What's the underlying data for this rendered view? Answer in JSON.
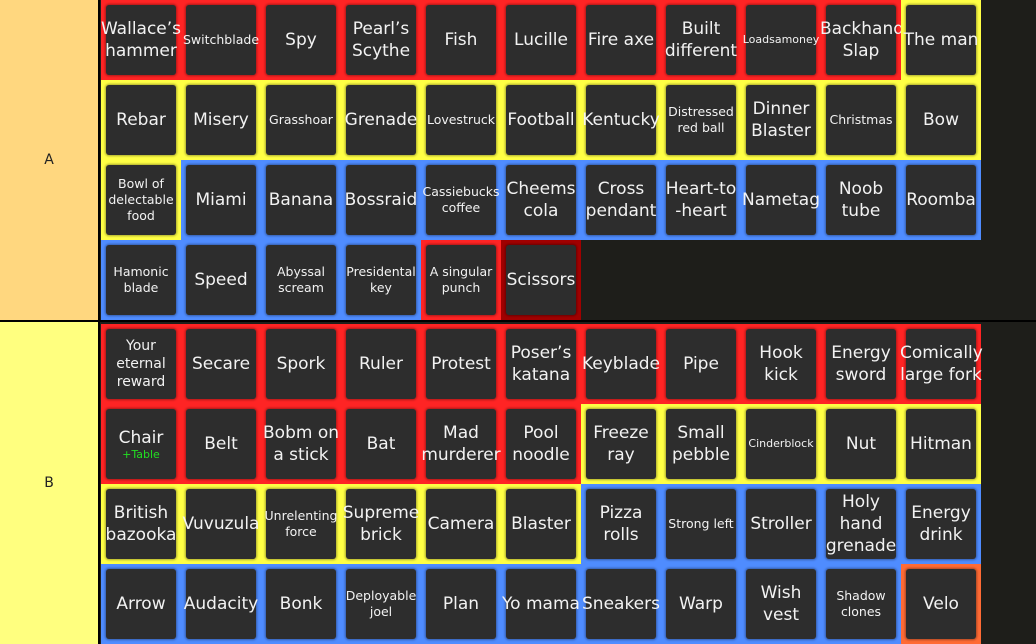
{
  "tiers": [
    {
      "label": "A",
      "items": [
        {
          "name": "Wallace's hammer",
          "color": "red",
          "size": "md"
        },
        {
          "name": "Switchblade",
          "color": "red",
          "size": "xs"
        },
        {
          "name": "Spy",
          "color": "red",
          "size": "lg"
        },
        {
          "name": "Pearl's Scythe",
          "color": "red",
          "size": "md"
        },
        {
          "name": "Fish",
          "color": "red",
          "size": "lg"
        },
        {
          "name": "Lucille",
          "color": "red",
          "size": "lg"
        },
        {
          "name": "Fire axe",
          "color": "red",
          "size": "lg"
        },
        {
          "name": "Built different",
          "color": "red",
          "size": "md"
        },
        {
          "name": "Loadsamoney",
          "color": "red",
          "size": "xxs"
        },
        {
          "name": "Backhand Slap",
          "color": "red",
          "size": "md"
        },
        {
          "name": "The man",
          "color": "yellow",
          "size": "lg"
        },
        {
          "name": "Rebar",
          "color": "yellow",
          "size": "lg"
        },
        {
          "name": "Misery",
          "color": "yellow",
          "size": "lg"
        },
        {
          "name": "Grasshoar",
          "color": "yellow",
          "size": "xs"
        },
        {
          "name": "Grenade",
          "color": "yellow",
          "size": "lg"
        },
        {
          "name": "Lovestruck",
          "color": "yellow",
          "size": "xs"
        },
        {
          "name": "Football",
          "color": "yellow",
          "size": "lg"
        },
        {
          "name": "Kentucky",
          "color": "yellow",
          "size": "md"
        },
        {
          "name": "Distressed red ball",
          "color": "yellow",
          "size": "xs"
        },
        {
          "name": "Dinner Blaster",
          "color": "yellow",
          "size": "md"
        },
        {
          "name": "Christmas",
          "color": "yellow",
          "size": "xs"
        },
        {
          "name": "Bow",
          "color": "yellow",
          "size": "lg"
        },
        {
          "name": "Bowl of delectable food",
          "color": "yellow",
          "size": "xs"
        },
        {
          "name": "Miami",
          "color": "blue",
          "size": "lg"
        },
        {
          "name": "Banana",
          "color": "blue",
          "size": "lg"
        },
        {
          "name": "Bossraid",
          "color": "blue",
          "size": "md"
        },
        {
          "name": "Cassiebucks coffee",
          "color": "blue",
          "size": "xs"
        },
        {
          "name": "Cheems cola",
          "color": "blue",
          "size": "md"
        },
        {
          "name": "Cross pendant",
          "color": "blue",
          "size": "md"
        },
        {
          "name": "Heart-to -heart",
          "color": "blue",
          "size": "md"
        },
        {
          "name": "Nametag",
          "color": "blue",
          "size": "md"
        },
        {
          "name": "Noob tube",
          "color": "blue",
          "size": "md"
        },
        {
          "name": "Roomba",
          "color": "blue",
          "size": "md"
        },
        {
          "name": "Hamonic blade",
          "color": "blue",
          "size": "xs"
        },
        {
          "name": "Speed",
          "color": "blue",
          "size": "lg"
        },
        {
          "name": "Abyssal scream",
          "color": "blue",
          "size": "xs"
        },
        {
          "name": "Presidental key",
          "color": "blue",
          "size": "xs"
        },
        {
          "name": "A singular punch",
          "color": "red",
          "size": "xs"
        },
        {
          "name": "Scissors",
          "color": "darkred",
          "size": "md"
        }
      ]
    },
    {
      "label": "B",
      "items": [
        {
          "name": "Your eternal reward",
          "color": "red",
          "size": "sm"
        },
        {
          "name": "Secare",
          "color": "red",
          "size": "md"
        },
        {
          "name": "Spork",
          "color": "red",
          "size": "md"
        },
        {
          "name": "Ruler",
          "color": "red",
          "size": "md"
        },
        {
          "name": "Protest",
          "color": "red",
          "size": "md"
        },
        {
          "name": "Poser's katana",
          "color": "red",
          "size": "md"
        },
        {
          "name": "Keyblade",
          "color": "red",
          "size": "md"
        },
        {
          "name": "Pipe",
          "color": "red",
          "size": "md"
        },
        {
          "name": "Hook kick",
          "color": "red",
          "size": "md"
        },
        {
          "name": "Energy sword",
          "color": "red",
          "size": "md"
        },
        {
          "name": "Comically large fork",
          "color": "red",
          "size": "md"
        },
        {
          "name": "Chair",
          "sub": "+Table",
          "color": "red",
          "size": "md"
        },
        {
          "name": "Belt",
          "color": "red",
          "size": "md"
        },
        {
          "name": "Bobm on a stick",
          "color": "red",
          "size": "md"
        },
        {
          "name": "Bat",
          "color": "red",
          "size": "md"
        },
        {
          "name": "Mad murderer",
          "color": "red",
          "size": "md"
        },
        {
          "name": "Pool noodle",
          "color": "red",
          "size": "md"
        },
        {
          "name": "Freeze ray",
          "color": "yellow",
          "size": "md"
        },
        {
          "name": "Small pebble",
          "color": "yellow",
          "size": "md"
        },
        {
          "name": "Cinderblock",
          "color": "yellow",
          "size": "xxs"
        },
        {
          "name": "Nut",
          "color": "yellow",
          "size": "md"
        },
        {
          "name": "Hitman",
          "color": "yellow",
          "size": "md"
        },
        {
          "name": "British bazooka",
          "color": "yellow",
          "size": "md"
        },
        {
          "name": "Vuvuzula",
          "color": "yellow",
          "size": "md"
        },
        {
          "name": "Unrelenting force",
          "color": "yellow",
          "size": "xs"
        },
        {
          "name": "Supreme brick",
          "color": "yellow",
          "size": "md"
        },
        {
          "name": "Camera",
          "color": "yellow",
          "size": "md"
        },
        {
          "name": "Blaster",
          "color": "yellow",
          "size": "md"
        },
        {
          "name": "Pizza rolls",
          "color": "blue",
          "size": "md"
        },
        {
          "name": "Strong left",
          "color": "blue",
          "size": "xs"
        },
        {
          "name": "Stroller",
          "color": "blue",
          "size": "md"
        },
        {
          "name": "Holy hand grenade",
          "color": "blue",
          "size": "md"
        },
        {
          "name": "Energy drink",
          "color": "blue",
          "size": "md"
        },
        {
          "name": "Arrow",
          "color": "blue",
          "size": "md"
        },
        {
          "name": "Audacity",
          "color": "blue",
          "size": "md"
        },
        {
          "name": "Bonk",
          "color": "blue",
          "size": "md"
        },
        {
          "name": "Deployable joel",
          "color": "blue",
          "size": "xs"
        },
        {
          "name": "Plan",
          "color": "blue",
          "size": "md"
        },
        {
          "name": "Yo mama",
          "color": "blue",
          "size": "md"
        },
        {
          "name": "Sneakers",
          "color": "blue",
          "size": "md"
        },
        {
          "name": "Warp",
          "color": "blue",
          "size": "md"
        },
        {
          "name": "Wish vest",
          "color": "blue",
          "size": "md"
        },
        {
          "name": "Shadow clones",
          "color": "blue",
          "size": "xs"
        },
        {
          "name": "Velo",
          "color": "orange",
          "size": "md"
        }
      ]
    }
  ],
  "colors": {
    "red": "#ff2424",
    "yellow": "#ffff44",
    "blue": "#4f8cff",
    "darkred": "#a00000",
    "orange": "#ff6b35",
    "tile": "#2d2d2d",
    "tier_a_label_bg": "#ffd77f",
    "tier_b_label_bg": "#ffff7f",
    "sub_label": "#22dd22"
  }
}
